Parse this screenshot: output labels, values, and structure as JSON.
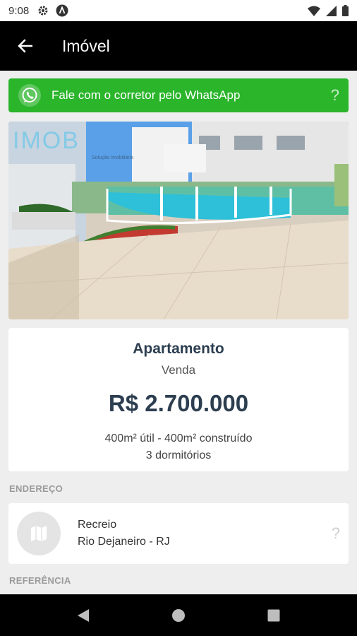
{
  "status_bar": {
    "time": "9:08"
  },
  "app_bar": {
    "title": "Imóvel"
  },
  "whatsapp_banner": {
    "text": "Fale com o corretor pelo WhatsApp",
    "help": "?"
  },
  "photo": {
    "logo_text": "IMOB",
    "logo_sub": "Solução Imobiliária"
  },
  "property": {
    "type": "Apartamento",
    "deal": "Venda",
    "price": "R$ 2.700.000",
    "area": "400m² útil - 400m² construído",
    "rooms": "3 dormitórios"
  },
  "address_section": {
    "label": "ENDEREÇO",
    "neighborhood": "Recreio",
    "city_state": "Rio Dejaneiro - RJ",
    "help": "?"
  },
  "reference_section": {
    "label": "REFERÊNCIA"
  },
  "colors": {
    "whatsapp_green": "#2bb52b",
    "app_bar": "#000000",
    "text_dark": "#2c3e50"
  }
}
